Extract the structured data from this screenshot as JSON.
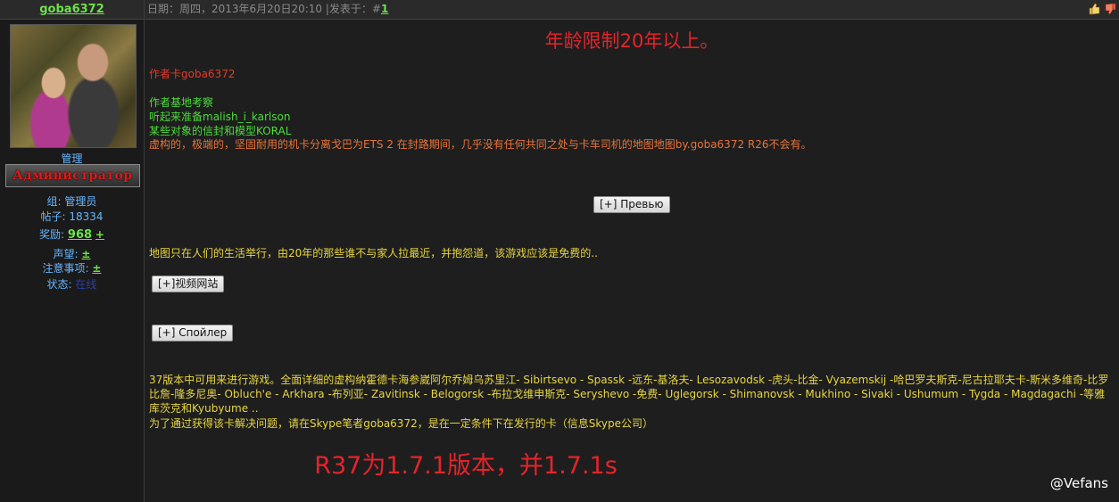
{
  "user": {
    "name": "goba6372",
    "role": "管理",
    "rank_badge": "Администратор",
    "group_label": "组:",
    "group_value": "管理员",
    "posts_label": "帖子:",
    "posts_value": "18334",
    "reward_label": "奖励:",
    "reward_value": "968",
    "reward_plus": "+",
    "reputation_label": "声望:",
    "reputation_value": "±",
    "notes_label": "注意事项:",
    "notes_value": "±",
    "status_label": "状态:",
    "status_value": "在线"
  },
  "post": {
    "header_meta": "日期：周四，2013年6月20日20:10 |发表于：#",
    "number": "1",
    "title": "年龄限制20年以上。",
    "author_line": "作者卡goba6372",
    "lines_green": [
      "作者基地考察",
      "听起来准备malish_i_karlson",
      "某些对象的信封和模型KORAL"
    ],
    "line_orange": "虚构的，极端的，坚固耐用的机卡分离戈巴为ETS 2 在封路期间，几乎没有任何共同之处与卡车司机的地图地图by.goba6372 R26不会有。",
    "preview_button": "[+] Превью",
    "map_line": "地图只在人们的生活举行，由20年的那些谁不与家人拉最近，并抱怨道，该游戏应该是免费的..",
    "video_button": "[+]视频网站",
    "spoiler_button": "[+] Спойлер",
    "long_paragraph": "37版本中可用来进行游戏。全面详细的虚构纳霍德卡海参崴阿尔乔姆乌苏里江- Sibirtsevo - Spassk -远东-基洛夫- Lesozavodsk -虎头-比金- Vyazemskij -哈巴罗夫斯克-尼古拉耶夫卡-斯米多维奇-比罗比詹-隆多尼奥- Obluch'e - Arkhara -布列亚- Zavitinsk - Belogorsk -布拉戈维申斯克- Seryshevo -免费- Uglegorsk - Shimanovsk - Mukhino - Sivaki - Ushumum - Tygda - Magdagachi -等雅库茨克和Kyubyume ..",
    "skype_line": "为了通过获得该卡解决问题，请在Skype笔者goba6372，是在一定条件下在发行的卡（信息Skype公司）",
    "footer_title": "R37为1.7.1版本，并1.7.1s"
  },
  "watermark": "@Vefans",
  "icons": [
    "thumbs-up-icon",
    "thumbs-down-icon"
  ]
}
